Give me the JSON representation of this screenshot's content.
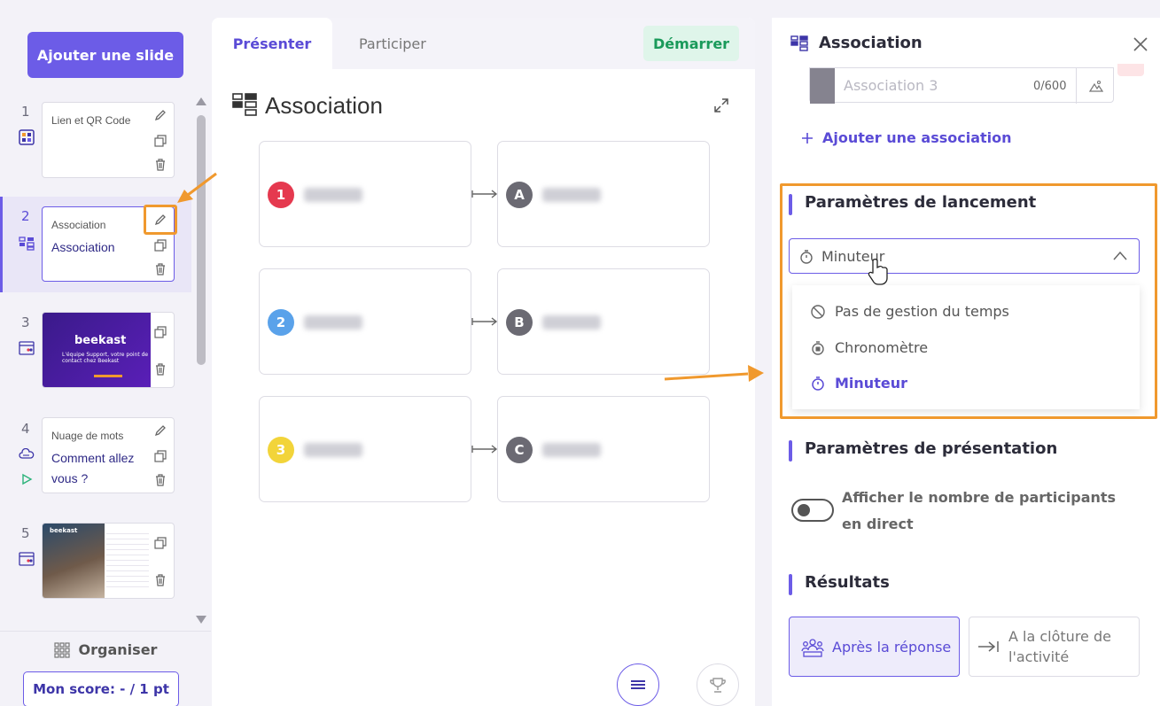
{
  "sidebar": {
    "add_slide_label": "Ajouter une slide",
    "slides": [
      {
        "num": "1",
        "subtitle": "Lien et QR Code",
        "main": ""
      },
      {
        "num": "2",
        "subtitle": "Association",
        "main": "Association"
      },
      {
        "num": "3",
        "subtitle": "",
        "main": "",
        "thumb_brand": "beekast",
        "thumb_text": "L'équipe Support, votre point de contact chez Beekast"
      },
      {
        "num": "4",
        "subtitle": "Nuage de mots",
        "main_line1": "Comment allez",
        "main_line2": "vous ?"
      },
      {
        "num": "5",
        "subtitle": "",
        "main": "",
        "thumb_brand": "beekast"
      }
    ],
    "organise_label": "Organiser",
    "score_label": "Mon score: - / 1 pt"
  },
  "center": {
    "tabs": [
      {
        "label": "Présenter"
      },
      {
        "label": "Participer"
      }
    ],
    "start_label": "Démarrer",
    "title": "Association",
    "pairs": [
      {
        "left_badge": "1",
        "right_badge": "A",
        "badge_color": "#e5394f"
      },
      {
        "left_badge": "2",
        "right_badge": "B",
        "badge_color": "#5aa2ea"
      },
      {
        "left_badge": "3",
        "right_badge": "C",
        "badge_color": "#f2d43a"
      }
    ],
    "right_badge_color": "#6b6a73"
  },
  "panel": {
    "title": "Association",
    "assoc_placeholder": "Association 3",
    "assoc_count": "0/600",
    "add_association_label": "Ajouter une association",
    "launch_title": "Paramètres de lancement",
    "timer_selected": "Minuteur",
    "timer_options": [
      {
        "label": "Pas de gestion du temps"
      },
      {
        "label": "Chronomètre"
      },
      {
        "label": "Minuteur"
      }
    ],
    "presentation_title": "Paramètres de présentation",
    "toggle_label": "Afficher le nombre de participants en direct",
    "results_title": "Résultats",
    "results_options": [
      {
        "label": "Après la réponse"
      },
      {
        "label": "A la clôture de l'activité"
      }
    ]
  },
  "colors": {
    "accent": "#6c5ce7",
    "annotation": "#f0992e",
    "start_green": "#1a9a5a"
  }
}
